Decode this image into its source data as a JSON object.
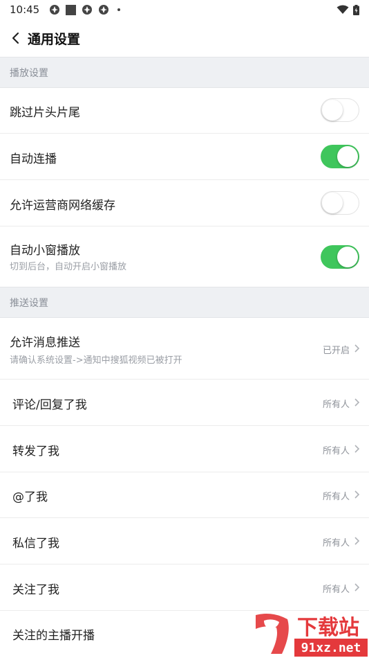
{
  "status_bar": {
    "time": "10:45"
  },
  "nav": {
    "title": "通用设置"
  },
  "sections": {
    "playback": {
      "header": "播放设置",
      "items": [
        {
          "label": "跳过片头片尾",
          "enabled": false
        },
        {
          "label": "自动连播",
          "enabled": true
        },
        {
          "label": "允许运营商网络缓存",
          "enabled": false
        },
        {
          "label": "自动小窗播放",
          "sublabel": "切到后台，自动开启小窗播放",
          "enabled": true
        }
      ]
    },
    "push": {
      "header": "推送设置",
      "items": [
        {
          "label": "允许消息推送",
          "sublabel": "请确认系统设置->通知中搜狐视频已被打开",
          "value": "已开启"
        },
        {
          "label": "评论/回复了我",
          "value": "所有人"
        },
        {
          "label": "转发了我",
          "value": "所有人"
        },
        {
          "label": "@了我",
          "value": "所有人"
        },
        {
          "label": "私信了我",
          "value": "所有人"
        },
        {
          "label": "关注了我",
          "value": "所有人"
        },
        {
          "label": "关注的主播开播",
          "value": ""
        }
      ]
    }
  },
  "watermark": {
    "text": "下载站",
    "domain": "91xz.net"
  },
  "colors": {
    "toggle_on": "#3fc65c",
    "section_bg": "#eef0f3",
    "watermark_red": "#e4393c"
  }
}
